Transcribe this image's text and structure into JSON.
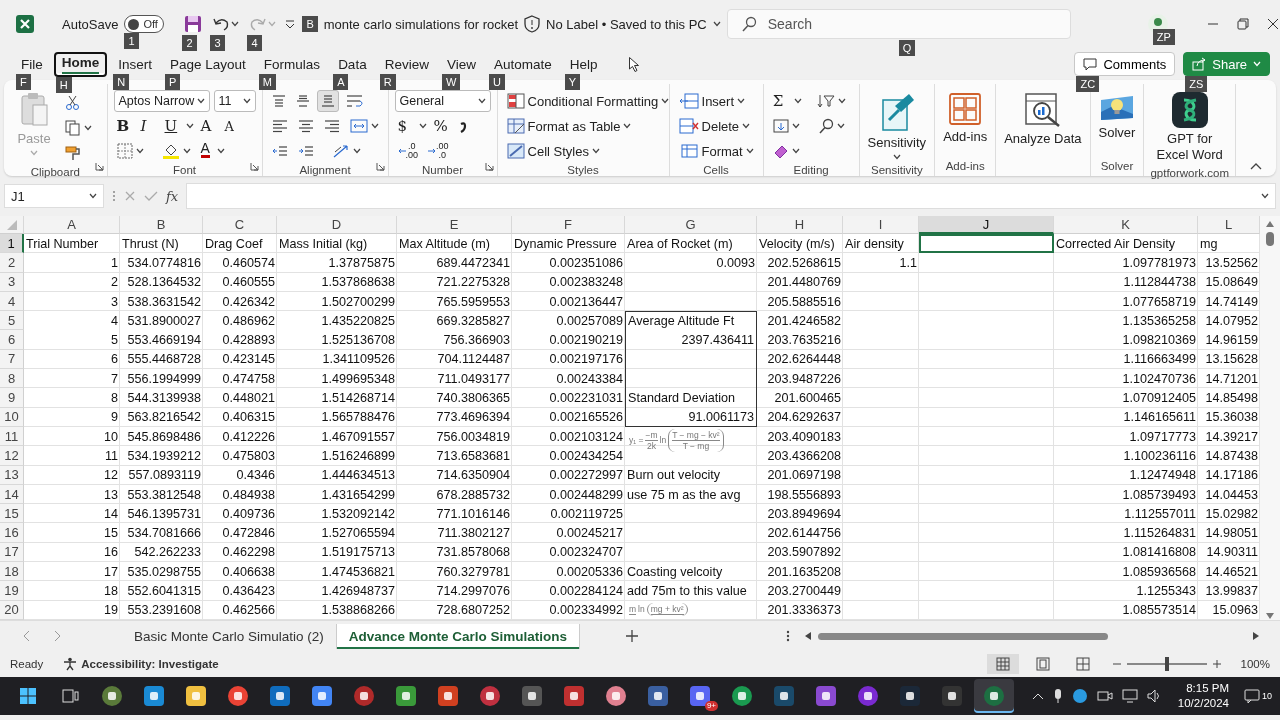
{
  "title_bar": {
    "autosave": {
      "label": "AutoSave",
      "state": "Off",
      "on": false,
      "keytip": "1"
    },
    "save": {
      "keytip": "2"
    },
    "undo": {
      "keytip": "3",
      "disabled": false
    },
    "redo": {
      "keytip": "4",
      "disabled": true
    },
    "title_keytip": "B",
    "title": "monte carlo simulations for rocket",
    "status": "No Label • Saved to this PC",
    "search": {
      "placeholder": "Search",
      "keytip": "Q"
    },
    "account_keytip": "ZP"
  },
  "tabs": [
    {
      "label": "File",
      "keytip": "F",
      "selected": false
    },
    {
      "label": "Home",
      "keytip": "H",
      "selected": true
    },
    {
      "label": "Insert",
      "keytip": "N",
      "selected": false
    },
    {
      "label": "Page Layout",
      "keytip": "P",
      "selected": false
    },
    {
      "label": "Formulas",
      "keytip": "M",
      "selected": false
    },
    {
      "label": "Data",
      "keytip": "A",
      "selected": false
    },
    {
      "label": "Review",
      "keytip": "R",
      "selected": false
    },
    {
      "label": "View",
      "keytip": "W",
      "selected": false
    },
    {
      "label": "Automate",
      "keytip": "U",
      "selected": false
    },
    {
      "label": "Help",
      "keytip": "Y",
      "selected": false
    }
  ],
  "comments": {
    "label": "Comments",
    "keytip": "ZC"
  },
  "share": {
    "label": "Share",
    "keytip": "ZS"
  },
  "ribbon": {
    "groups": [
      {
        "kind": "clipboard",
        "label": "Clipboard",
        "dialog_launcher": true,
        "items": [
          {
            "label": "Paste",
            "disabled": true
          }
        ]
      },
      {
        "kind": "font",
        "label": "Font",
        "dialog_launcher": true,
        "font": "Aptos Narrow",
        "size": "11",
        "style_buttons": [
          "B",
          "I",
          "U"
        ],
        "grow": "A",
        "shrink": "A",
        "color_letter": "A"
      },
      {
        "kind": "alignment",
        "label": "Alignment",
        "dialog_launcher": true,
        "vertical": [
          {
            "selected": false
          },
          {
            "selected": false
          },
          {
            "selected": true
          }
        ]
      },
      {
        "kind": "number",
        "label": "Number",
        "dialog_launcher": true,
        "format": "General",
        "symbols": [
          "$",
          "%"
        ],
        "increase_decimal": [
          ".0",
          ".00"
        ],
        "decrease_decimal": [
          ".00",
          ".0"
        ]
      },
      {
        "kind": "list",
        "label": "Styles",
        "items": [
          {
            "label": "Conditional Formatting"
          },
          {
            "label": "Format as Table"
          },
          {
            "label": "Cell Styles"
          }
        ]
      },
      {
        "kind": "list",
        "label": "Cells",
        "items": [
          {
            "label": "Insert"
          },
          {
            "label": "Delete"
          },
          {
            "label": "Format"
          }
        ]
      },
      {
        "kind": "editing",
        "label": "Editing",
        "autosum": "Σ"
      },
      {
        "kind": "large",
        "label": "Sensitivity",
        "items": [
          {
            "label": "Sensitivity"
          }
        ]
      },
      {
        "kind": "large",
        "label": "Add-ins",
        "items": [
          {
            "label": "Add-ins"
          }
        ]
      },
      {
        "kind": "large",
        "items": [
          {
            "label": "Analyze Data"
          }
        ]
      },
      {
        "kind": "large",
        "label": "Solver",
        "items": [
          {
            "label": "Solver"
          }
        ]
      },
      {
        "kind": "large",
        "label": "gptforwork.com",
        "items": [
          {
            "label": "GPT for Excel Word"
          }
        ]
      }
    ]
  },
  "formula_bar": {
    "name_box": "J1",
    "function_label": "fx"
  },
  "table": {
    "columns": [
      {
        "letter": "A",
        "selected": false
      },
      {
        "letter": "B",
        "selected": false
      },
      {
        "letter": "C",
        "selected": false
      },
      {
        "letter": "D",
        "selected": false
      },
      {
        "letter": "E",
        "selected": false
      },
      {
        "letter": "F",
        "selected": false
      },
      {
        "letter": "G",
        "selected": false
      },
      {
        "letter": "H",
        "selected": false
      },
      {
        "letter": "I",
        "selected": false
      },
      {
        "letter": "J",
        "selected": true
      },
      {
        "letter": "K",
        "selected": false
      },
      {
        "letter": "L",
        "selected": false
      }
    ],
    "rows": [
      {
        "number": "1",
        "selected": true,
        "cells": [
          {
            "kind": "text",
            "text": "Trial Number"
          },
          {
            "kind": "text",
            "text": "Thrust (N)"
          },
          {
            "kind": "text",
            "text": "Drag Coef"
          },
          {
            "kind": "text",
            "text": "Mass Initial (kg)"
          },
          {
            "kind": "text",
            "text": "Max Altitude (m)"
          },
          {
            "kind": "text",
            "text": "Dynamic Pressure"
          },
          {
            "kind": "text",
            "text": "Area of Rocket (m)"
          },
          {
            "kind": "text",
            "text": "Velocity (m/s)"
          },
          {
            "kind": "text",
            "text": "Air density"
          },
          null,
          {
            "kind": "text",
            "text": "Corrected Air Density"
          },
          {
            "kind": "text",
            "text": "mg"
          }
        ]
      },
      {
        "number": "2",
        "selected": false,
        "cells": [
          "1",
          "534.0774816",
          "0.460574",
          "1.37875875",
          "689.4472341",
          "0.002351086",
          "0.0093",
          "202.5268615",
          "1.1",
          null,
          "1.097781973",
          "13.52562"
        ]
      },
      {
        "number": "3",
        "selected": false,
        "cells": [
          "2",
          "528.1364532",
          "0.460555",
          "1.537868638",
          "721.2275328",
          "0.002383248",
          null,
          "201.4480769",
          null,
          null,
          "1.112844738",
          "15.08649"
        ]
      },
      {
        "number": "4",
        "selected": false,
        "cells": [
          "3",
          "538.3631542",
          "0.426342",
          "1.502700299",
          "765.5959553",
          "0.002136447",
          null,
          "205.5885516",
          null,
          null,
          "1.077658719",
          "14.74149"
        ]
      },
      {
        "number": "5",
        "selected": false,
        "cells": [
          "4",
          "531.8900027",
          "0.486962",
          "1.435220825",
          "669.3285827",
          "0.00257089",
          {
            "kind": "text",
            "text": "Average Altitude Ft",
            "outlined": true
          },
          "201.4246582",
          null,
          null,
          "1.135365258",
          "14.07952"
        ]
      },
      {
        "number": "6",
        "selected": false,
        "cells": [
          "5",
          "553.4669194",
          "0.428893",
          "1.525136708",
          "756.366903",
          "0.002190219",
          {
            "kind": "number",
            "text": "2397.436411",
            "outlined": true
          },
          "203.7635216",
          null,
          null,
          "1.098210369",
          "14.96159"
        ]
      },
      {
        "number": "7",
        "selected": false,
        "cells": [
          "6",
          "555.4468728",
          "0.423145",
          "1.341109526",
          "704.1124487",
          "0.002197176",
          {
            "kind": "blank",
            "outlined": true
          },
          "202.6264448",
          null,
          null,
          "1.116663499",
          "13.15628"
        ]
      },
      {
        "number": "8",
        "selected": false,
        "cells": [
          "7",
          "556.1994999",
          "0.474758",
          "1.499695348",
          "711.0493177",
          "0.00243384",
          {
            "kind": "blank",
            "outlined": true
          },
          "203.9487226",
          null,
          null,
          "1.102470736",
          "14.71201"
        ]
      },
      {
        "number": "9",
        "selected": false,
        "cells": [
          "8",
          "544.3139938",
          "0.448021",
          "1.514268714",
          "740.3806365",
          "0.002231031",
          {
            "kind": "text",
            "text": "Standard Deviation",
            "outlined": true
          },
          "201.600465",
          null,
          null,
          "1.070912405",
          "14.85498"
        ]
      },
      {
        "number": "10",
        "selected": false,
        "cells": [
          "9",
          "563.8216542",
          "0.406315",
          "1.565788476",
          "773.4696394",
          "0.002165526",
          {
            "kind": "number",
            "text": "91.0061173",
            "outlined": true
          },
          "204.6292637",
          null,
          null,
          "1.146165611",
          "15.36038"
        ]
      },
      {
        "number": "11",
        "selected": false,
        "cells": [
          "10",
          "545.8698486",
          "0.412226",
          "1.467091557",
          "756.0034819",
          "0.002103124",
          {
            "kind": "formula",
            "lhs": "y₁ =",
            "num": "−m",
            "den": "2k",
            "fn": "ln",
            "inner_num": "T − mg − kv²",
            "inner_den": "T − mg"
          },
          "203.4090183",
          null,
          null,
          "1.09717773",
          "14.39217"
        ]
      },
      {
        "number": "12",
        "selected": false,
        "cells": [
          "11",
          "534.1939212",
          "0.475803",
          "1.516246899",
          "713.6583681",
          "0.002434254",
          null,
          "203.4366208",
          null,
          null,
          "1.100236116",
          "14.87438"
        ]
      },
      {
        "number": "13",
        "selected": false,
        "cells": [
          "12",
          "557.0893119",
          "0.4346",
          "1.444634513",
          "714.6350904",
          "0.002272997",
          {
            "kind": "text",
            "text": "Burn out velocity"
          },
          "201.0697198",
          null,
          null,
          "1.12474948",
          "14.17186"
        ]
      },
      {
        "number": "14",
        "selected": false,
        "cells": [
          "13",
          "553.3812548",
          "0.484938",
          "1.431654299",
          "678.2885732",
          "0.002448299",
          {
            "kind": "text",
            "text": "use 75 m as the avg"
          },
          "198.5556893",
          null,
          null,
          "1.085739493",
          "14.04453"
        ]
      },
      {
        "number": "15",
        "selected": false,
        "cells": [
          "14",
          "546.1395731",
          "0.409736",
          "1.532092142",
          "771.1016146",
          "0.002119725",
          null,
          "203.8949694",
          null,
          null,
          "1.112557011",
          "15.02982"
        ]
      },
      {
        "number": "16",
        "selected": false,
        "cells": [
          "15",
          "534.7081666",
          "0.472846",
          "1.527065594",
          "711.3802127",
          "0.00245217",
          null,
          "202.6144756",
          null,
          null,
          "1.115264831",
          "14.98051"
        ]
      },
      {
        "number": "17",
        "selected": false,
        "cells": [
          "16",
          "542.262233",
          "0.462298",
          "1.519175713",
          "731.8578068",
          "0.002324707",
          null,
          "203.5907892",
          null,
          null,
          "1.081416808",
          "14.90311"
        ]
      },
      {
        "number": "18",
        "selected": false,
        "cells": [
          "17",
          "535.0298755",
          "0.406638",
          "1.474536821",
          "760.3279781",
          "0.00205336",
          {
            "kind": "text",
            "text": "Coasting velcoity"
          },
          "201.1635208",
          null,
          null,
          "1.085936568",
          "14.46521"
        ]
      },
      {
        "number": "19",
        "selected": false,
        "cells": [
          "18",
          "552.6041315",
          "0.436423",
          "1.426948737",
          "714.2997076",
          "0.002284124",
          {
            "kind": "text",
            "text": "add 75m to this value"
          },
          "203.2700449",
          null,
          null,
          "1.1255343",
          "13.99837"
        ]
      },
      {
        "number": "20",
        "selected": false,
        "cells": [
          "19",
          "553.2391608",
          "0.462566",
          "1.538868266",
          "728.6807252",
          "0.002334992",
          {
            "kind": "formula",
            "num": "m",
            "fn": "ln",
            "inner_num": "mg + kv²"
          },
          "201.3336373",
          null,
          null,
          "1.085573514",
          "15.0963"
        ]
      }
    ]
  },
  "sheet_tabs": [
    {
      "label": "Basic Monte Carlo Simulatio (2)",
      "selected": false
    },
    {
      "label": "Advance Monte Carlo Simulations",
      "selected": true
    }
  ],
  "status_bar": {
    "mode": "Ready",
    "accessibility": "Accessibility: Investigate",
    "views": [
      {
        "selected": true
      },
      {
        "selected": false
      },
      {
        "selected": false
      }
    ],
    "zoom": {
      "level": 0.5,
      "reading": "100%"
    }
  },
  "taskbar": {
    "apps": [
      {
        "selected": false
      },
      {
        "selected": false
      },
      {
        "selected": false
      },
      {
        "selected": false
      },
      {
        "selected": false
      },
      {
        "selected": false
      },
      {
        "selected": false
      },
      {
        "selected": false
      },
      {
        "selected": false
      },
      {
        "selected": false
      },
      {
        "selected": false
      },
      {
        "selected": false
      },
      {
        "selected": false
      },
      {
        "selected": false
      },
      {
        "selected": false,
        "badge": "9+"
      },
      {
        "selected": false
      },
      {
        "selected": false
      },
      {
        "selected": false
      },
      {
        "selected": false
      },
      {
        "selected": false
      },
      {
        "selected": false
      },
      {
        "selected": true
      }
    ],
    "time": "8:15 PM",
    "date": "10/2/2024",
    "notifications": "10"
  }
}
